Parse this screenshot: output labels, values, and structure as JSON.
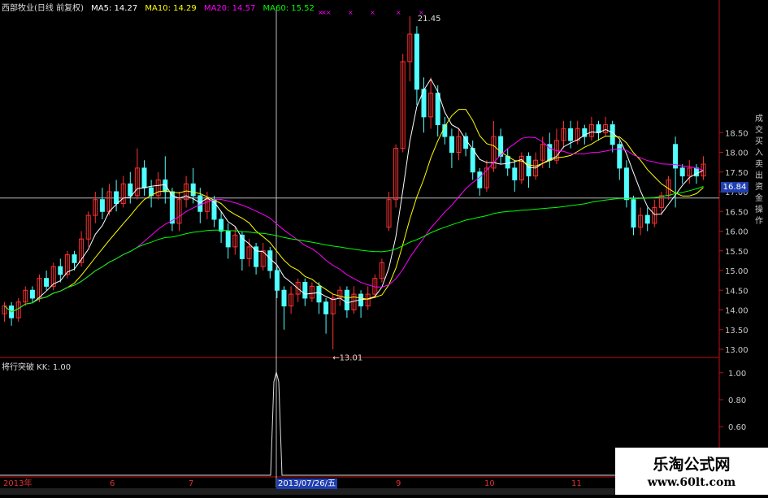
{
  "header": {
    "stock": "西部牧业(日线 前复权)",
    "ma5": "MA5: 14.27",
    "ma10": "MA10: 14.29",
    "ma20": "MA20: 14.57",
    "ma60": "MA60: 15.52"
  },
  "colors": {
    "up": "#ff3030",
    "down": "#50ffff",
    "ma5": "#ffffff",
    "ma10": "#ffff00",
    "ma20": "#ff00ff",
    "ma60": "#00ff00",
    "axis": "#c01010",
    "price_tag_bg": "#1f3fb0"
  },
  "annotations": {
    "high": "21.45",
    "low": "←13.01"
  },
  "current_price": "16.84",
  "price_ticks": [
    "18.50",
    "18.00",
    "17.50",
    "17.00",
    "16.50",
    "16.00",
    "15.50",
    "15.00",
    "14.50",
    "14.00",
    "13.50",
    "13.00"
  ],
  "indicator": {
    "header": "将行突破  KK: 1.00",
    "ticks": [
      "1.00",
      "0.80",
      "0.60",
      "0.40"
    ]
  },
  "x_labels": [
    "2013年",
    "6",
    "7",
    "9",
    "10",
    "11"
  ],
  "date_tag": "2013/07/26/五",
  "side_text": "成交买入卖出资金操作",
  "watermark": {
    "title": "乐淘公式网",
    "url": "www.60lt.com"
  }
}
